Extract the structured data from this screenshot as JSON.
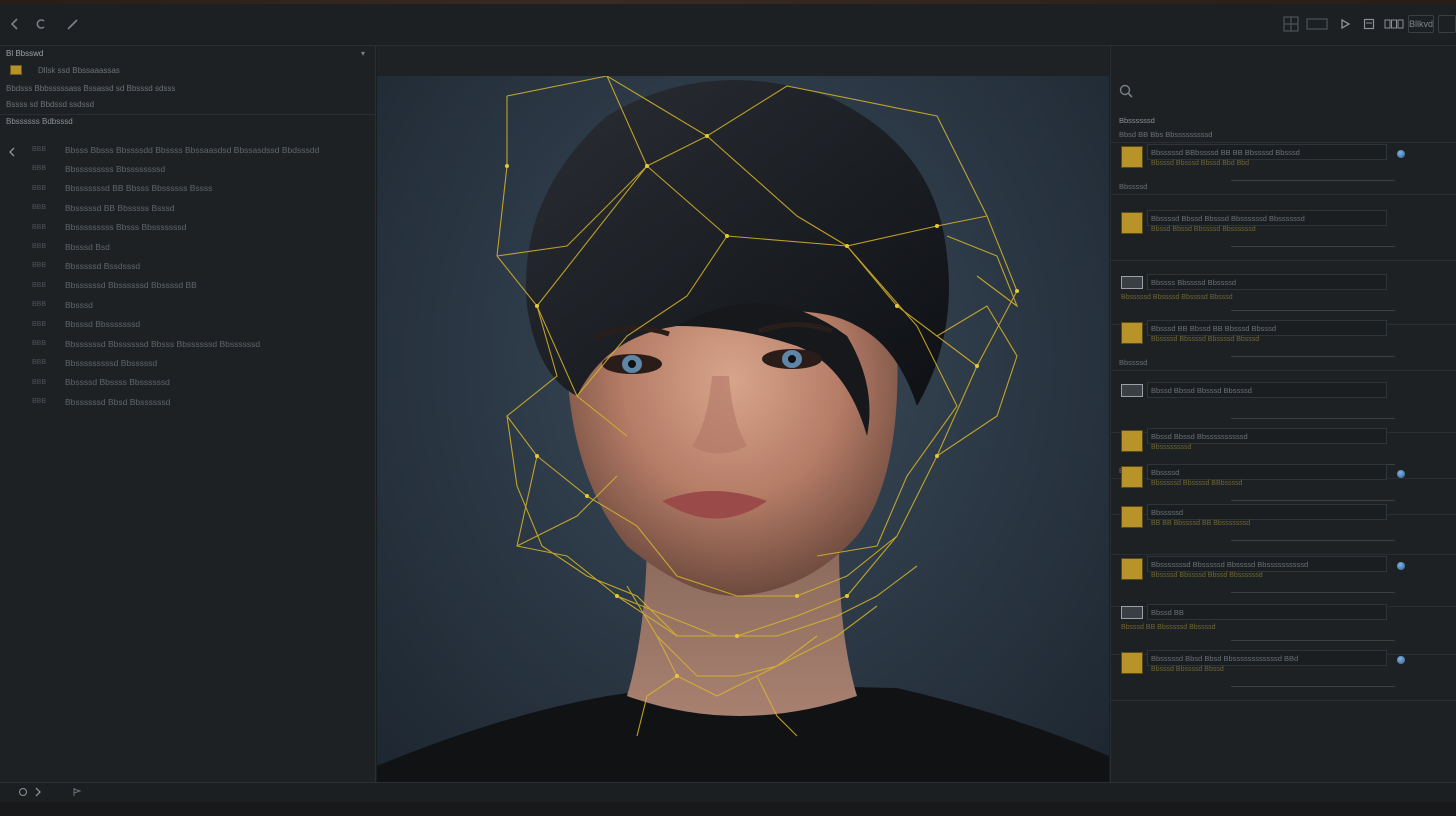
{
  "toolbar": {
    "right_labels": [
      "Bllkvd"
    ]
  },
  "left_panel": {
    "title": "Bl Bbsswd",
    "row1_label": "Dllsk ssd Bbssaaassas",
    "row2_label": "Bbdsss Bbbsssssass Bssassd sd Bbsssd sdsss",
    "row3_label": "Bssss sd Bbdssd ssdssd",
    "section_label": "Bbssssss Bdbsssd",
    "items": [
      {
        "num": "BBB",
        "label": "Bbsss Bbsss Bbssssdd Bbssss Bbssaasdsd Bbssasdssd Bbdsssdd"
      },
      {
        "num": "BBB",
        "label": "Bbsssssssss Bbssssssssd"
      },
      {
        "num": "BBB",
        "label": "Bbsssssssd BB Bbsss Bbssssss Bssss"
      },
      {
        "num": "BBB",
        "label": "Bbsssssd BB Bbsssss Bsssd"
      },
      {
        "num": "BBB",
        "label": "Bbsssssssss Bbsss Bbsssssssd"
      },
      {
        "num": "BBB",
        "label": "Bbsssd Bsd"
      },
      {
        "num": "BBB",
        "label": "Bbsssssd Bssdsssd"
      },
      {
        "num": "BBB",
        "label": "Bbssssssd Bbssssssd Bbssssd BB"
      },
      {
        "num": "BBB",
        "label": "Bbsssd"
      },
      {
        "num": "BBB",
        "label": "Bbsssd Bbsssssssd"
      },
      {
        "num": "BBB",
        "label": "Bbssssssd Bbssssssd Bbsss Bbssssssd Bbssssssd"
      },
      {
        "num": "BBB",
        "label": "Bbsssssssssd Bbsssssd"
      },
      {
        "num": "BBB",
        "label": "Bbssssd Bbssss Bbssssssd"
      },
      {
        "num": "BBB",
        "label": "Bbssssssd Bbsd Bbssssssd"
      }
    ]
  },
  "right_panel": {
    "header": "Bbssssssd",
    "subheader": "Bbsd BB Bbs Bbsssssssssd",
    "entries": [
      {
        "title": "Bbsssssd BBbssssd BB BB Bbssssd Bbsssd",
        "sub": "Bbsssd Bbsssd Bbssd Bbd Bbd",
        "extra": "Bbssssd"
      },
      {
        "title": "Bbssssd Bbssd Bbsssd Bbssssssd Bbssssssd",
        "sub": "Bbssd Bbssd Bbssssd Bbssssssd",
        "extra": ""
      },
      {
        "title": "Bbssss Bbssssd Bbssssd",
        "sub": "Bbsssssd Bbssssd Bbssssd Bbsssd",
        "extra": ""
      },
      {
        "title": "Bbsssd BB Bbssd BB Bbsssd Bbsssd",
        "sub": "Bbssssd Bbssssd Bbssssd Bbsssd",
        "extra": "Bbssssd"
      },
      {
        "title": "Bbssd Bbssd Bbsssd Bbssssd",
        "sub": "",
        "extra": ""
      },
      {
        "title": "Bbssd Bbssd Bbssssssssssd",
        "sub": "Bbssssssssd",
        "extra": "Bbsssd"
      },
      {
        "title": "Bbssssd",
        "sub": "Bbsssssd Bbssssd BBbssssd",
        "extra": ""
      },
      {
        "title": "Bbsssssd",
        "sub": "BB BB Bbssssd BB Bbsssssssd",
        "extra": ""
      },
      {
        "title": "Bbsssssssd Bbsssssd Bbssssd Bbssssssssssd",
        "sub": "Bbssssd Bbssssd Bbssd Bbssssssd",
        "extra": ""
      },
      {
        "title": "Bbssd BB",
        "sub": "Bbsssd BB Bbsssssd Bbssssd",
        "extra": ""
      },
      {
        "title": "Bbsssssd Bbsd Bbsd Bbssssssssssssd BBd",
        "sub": "Bbsssd Bbssssd Bbssd",
        "extra": ""
      }
    ]
  },
  "colors": {
    "accent": "#d8b62a",
    "mesh": "#e0c22c",
    "panel": "#1e2124",
    "viewer_bg": "#2d3a47"
  }
}
